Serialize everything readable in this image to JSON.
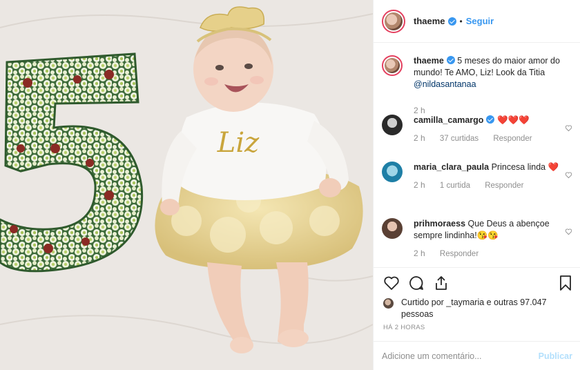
{
  "post": {
    "username": "thaeme",
    "follow_label": "Seguir",
    "separator": "•"
  },
  "caption": {
    "username": "thaeme",
    "text": "5 meses do maior amor do mundo! Te AMO, Liz! Look da Titia",
    "mention": "@nildasantanaa",
    "time": "2 h"
  },
  "comments": [
    {
      "username": "camilla_camargo",
      "verified": true,
      "text": "❤️❤️❤️",
      "time": "2 h",
      "likes": "37 curtidas",
      "reply": "Responder"
    },
    {
      "username": "maria_clara_paula",
      "verified": false,
      "text": "Princesa linda ❤️",
      "time": "2 h",
      "likes": "1 curtida",
      "reply": "Responder"
    },
    {
      "username": "prihmoraess",
      "verified": false,
      "text": "Que Deus a abençoe sempre lindinha!😘😘",
      "time": "2 h",
      "reply": "Responder"
    }
  ],
  "actions": {
    "icons": [
      "heart-icon",
      "comment-icon",
      "share-icon",
      "bookmark-icon"
    ],
    "liked_by": "Curtido por _taymaria e outras 97.047 pessoas",
    "posted_ago": "HÁ 2 HORAS"
  },
  "add_comment": {
    "placeholder": "Adicione um comentário...",
    "publish_label": "Publicar"
  },
  "photo": {
    "shirt_text": "Liz"
  },
  "colors": {
    "accent": "#3897f0",
    "heart": "#ed4956",
    "muted": "#8e8e8e",
    "publish_disabled": "#b2dffc"
  }
}
